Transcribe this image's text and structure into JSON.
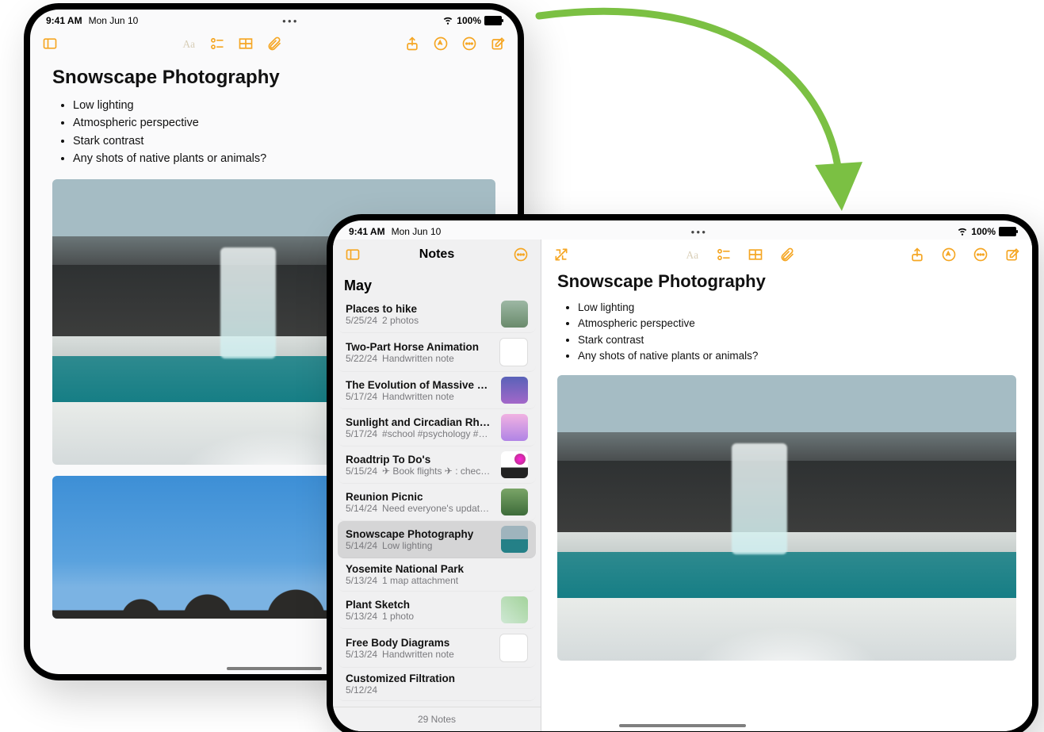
{
  "status": {
    "time": "9:41 AM",
    "date": "Mon Jun 10",
    "battery_label": "100%"
  },
  "colors": {
    "accent": "#f5a623",
    "arrow": "#7bc043"
  },
  "note": {
    "title": "Snowscape Photography",
    "bullets": [
      "Low lighting",
      "Atmospheric perspective",
      "Stark contrast",
      "Any shots of native plants or animals?"
    ],
    "images": [
      "snow-waterfall",
      "sky-mountains"
    ]
  },
  "sidebar": {
    "title": "Notes",
    "section": "May",
    "footer": "29 Notes",
    "items": [
      {
        "title": "Places to hike",
        "date": "5/25/24",
        "preview": "2 photos",
        "thumb": "t0"
      },
      {
        "title": "Two-Part Horse Animation",
        "date": "5/22/24",
        "preview": "Handwritten note",
        "thumb": "t1"
      },
      {
        "title": "The Evolution of Massive Star…",
        "date": "5/17/24",
        "preview": "Handwritten note",
        "thumb": "t2"
      },
      {
        "title": "Sunlight and Circadian Rhyth…",
        "date": "5/17/24",
        "preview": "#school #psychology #bio…",
        "thumb": "t3"
      },
      {
        "title": "Roadtrip To Do's",
        "date": "5/15/24",
        "preview": "✈︎ Book flights ✈︎ : check…",
        "thumb": "t4"
      },
      {
        "title": "Reunion Picnic",
        "date": "5/14/24",
        "preview": "Need everyone's updated…",
        "thumb": "t5"
      },
      {
        "title": "Snowscape Photography",
        "date": "5/14/24",
        "preview": "Low lighting",
        "thumb": "t6",
        "selected": true
      },
      {
        "title": "Yosemite National Park",
        "date": "5/13/24",
        "preview": "1 map attachment",
        "thumb": "t7"
      },
      {
        "title": "Plant Sketch",
        "date": "5/13/24",
        "preview": "1 photo",
        "thumb": "t8"
      },
      {
        "title": "Free Body Diagrams",
        "date": "5/13/24",
        "preview": "Handwritten note",
        "thumb": "t9"
      },
      {
        "title": "Customized Filtration",
        "date": "5/12/24",
        "preview": "",
        "thumb": "t10"
      }
    ]
  },
  "toolbar": {
    "icons_portrait_right": [
      "text-format-icon",
      "checklist-icon",
      "table-icon",
      "attachment-icon",
      "share-icon",
      "markup-icon",
      "more-icon",
      "compose-icon"
    ],
    "icons_landscape_sidebar": [
      "sidebar-toggle-icon",
      "more-icon"
    ],
    "icons_landscape_main_left": [
      "expand-icon"
    ],
    "icons_landscape_main_right": [
      "text-format-icon",
      "checklist-icon",
      "table-icon",
      "attachment-icon",
      "share-icon",
      "markup-icon",
      "more-icon",
      "compose-icon"
    ]
  }
}
